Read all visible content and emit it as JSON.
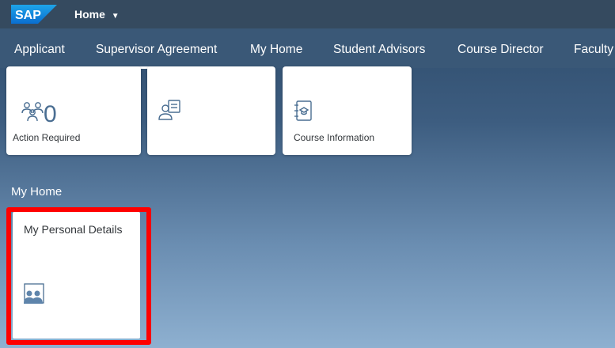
{
  "shell": {
    "logo_text": "SAP",
    "home_label": "Home",
    "home_caret": "▼"
  },
  "tabs": [
    {
      "label": "Applicant"
    },
    {
      "label": "Supervisor Agreement",
      "selected": true
    },
    {
      "label": "My Home"
    },
    {
      "label": "Student Advisors"
    },
    {
      "label": "Course Director"
    },
    {
      "label": "Faculty"
    }
  ],
  "tiles": [
    {
      "number": "0",
      "label": "Action Required",
      "icon": "group-people-icon"
    },
    {
      "number": "",
      "label": "",
      "icon": "person-document-icon"
    },
    {
      "number": "",
      "label": "Course Information",
      "icon": "notebook-graduation-icon"
    }
  ],
  "section": {
    "title": "My Home",
    "tile": {
      "title": "My Personal Details",
      "icon": "personal-details-icon"
    }
  },
  "colors": {
    "shell_bg": "#354a5f",
    "tab_bg": "#3a5877",
    "icon_blue": "#4a6e92",
    "highlight": "#ff0000"
  }
}
